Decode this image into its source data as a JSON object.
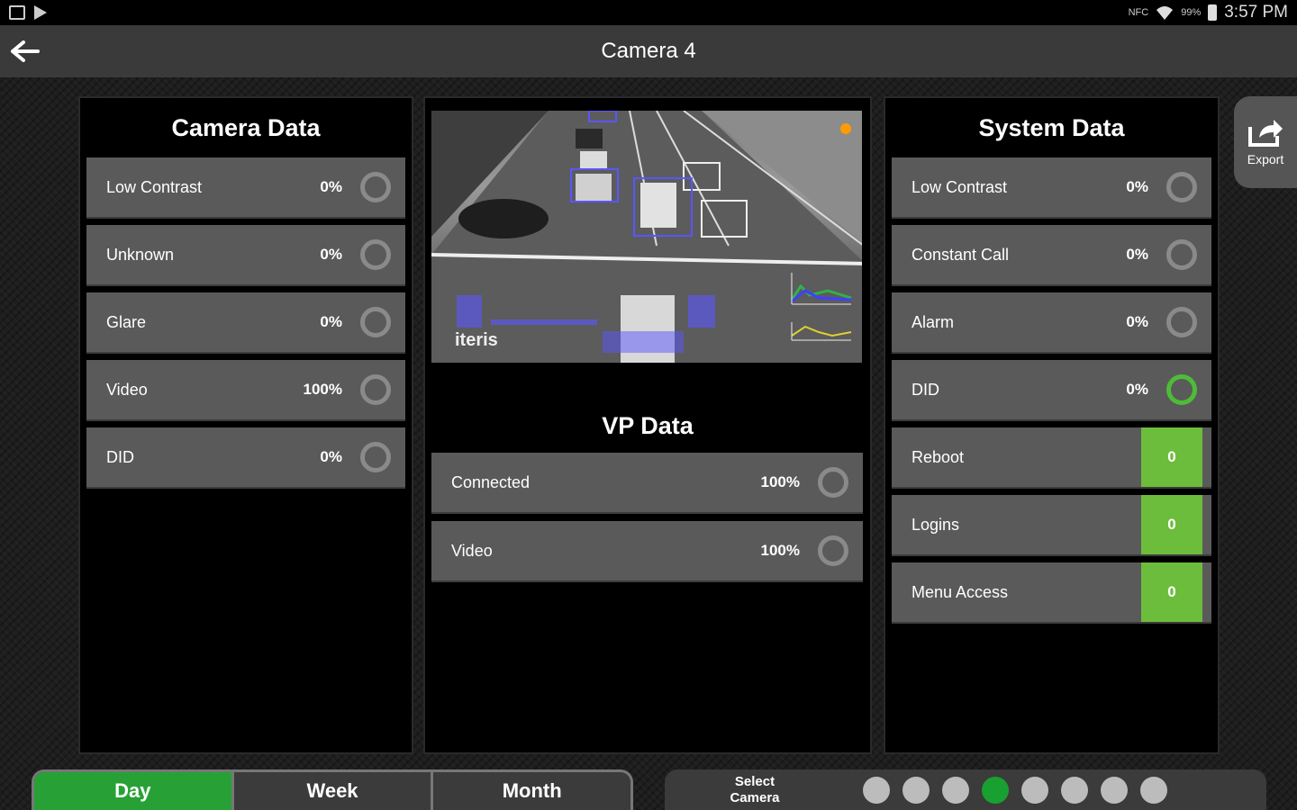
{
  "status_bar": {
    "signal_text": "NFC",
    "battery_text": "99%",
    "time": "3:57 PM"
  },
  "app_bar": {
    "title": "Camera 4",
    "back_icon": "arrow-left-icon"
  },
  "camera_data": {
    "title": "Camera Data",
    "rows": [
      {
        "label": "Low Contrast",
        "value": "0%",
        "status": "gray"
      },
      {
        "label": "Unknown",
        "value": "0%",
        "status": "gray"
      },
      {
        "label": "Glare",
        "value": "0%",
        "status": "gray"
      },
      {
        "label": "Video",
        "value": "100%",
        "status": "gray"
      },
      {
        "label": "DID",
        "value": "0%",
        "status": "gray"
      }
    ]
  },
  "vp_data": {
    "video_watermark": "iteris",
    "title": "VP Data",
    "rows": [
      {
        "label": "Connected",
        "value": "100%",
        "status": "gray"
      },
      {
        "label": "Video",
        "value": "100%",
        "status": "gray"
      }
    ]
  },
  "system_data": {
    "title": "System Data",
    "rows": [
      {
        "label": "Low Contrast",
        "value": "0%",
        "status": "gray"
      },
      {
        "label": "Constant Call",
        "value": "0%",
        "status": "gray"
      },
      {
        "label": "Alarm",
        "value": "0%",
        "status": "gray"
      },
      {
        "label": "DID",
        "value": "0%",
        "status": "green"
      }
    ],
    "counters": [
      {
        "label": "Reboot",
        "count": "0"
      },
      {
        "label": "Logins",
        "count": "0"
      },
      {
        "label": "Menu Access",
        "count": "0"
      }
    ]
  },
  "export": {
    "label": "Export",
    "icon": "export-icon"
  },
  "period": {
    "tabs": [
      "Day",
      "Week",
      "Month"
    ],
    "active": "Day"
  },
  "camera_selector": {
    "label": "Select\nCamera",
    "camera_count": 8,
    "active_index": 3
  },
  "colors": {
    "accent_green": "#27a136",
    "counter_green": "#6cbd3b",
    "ring_gray": "#8a8a8a",
    "row_gray": "#5a5a5a"
  }
}
